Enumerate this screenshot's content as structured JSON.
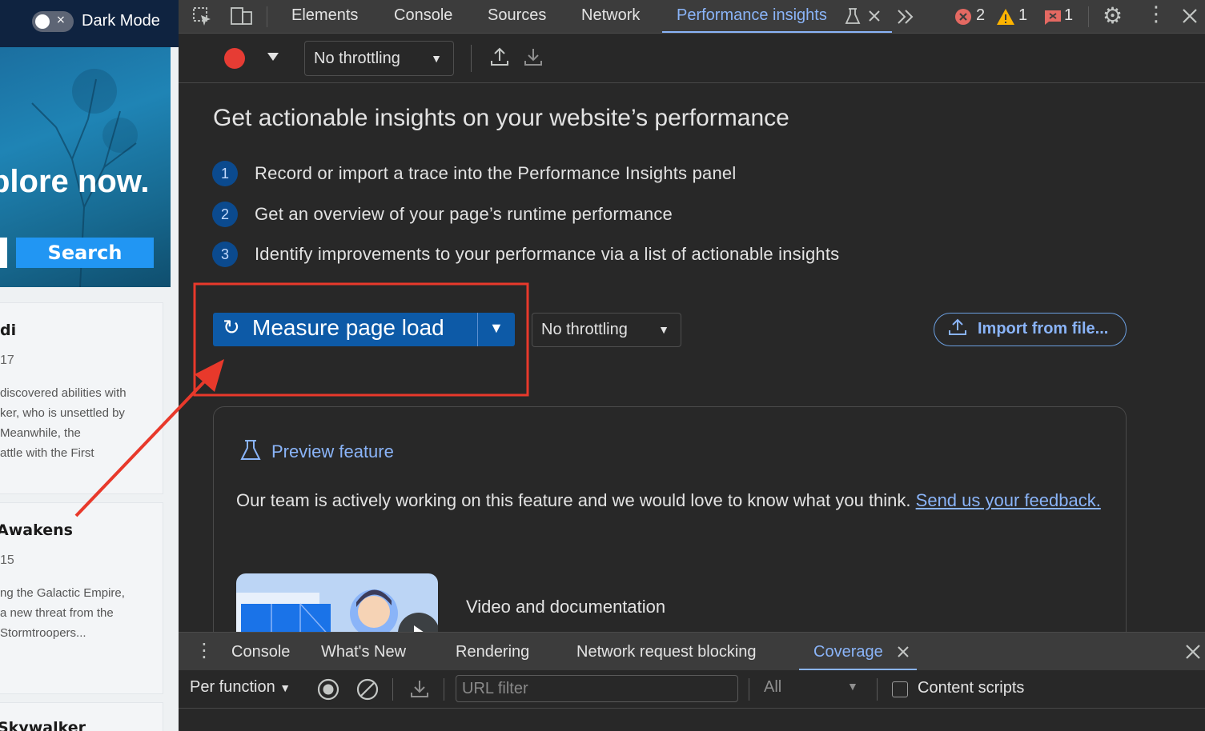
{
  "site": {
    "dark_mode_label": "Dark Mode",
    "toggle_x": "×",
    "hero_text": "plore now.",
    "search_label": "Search",
    "cards": [
      {
        "title": "di",
        "year": "17",
        "desc": [
          "discovered abilities with",
          "ker, who is unsettled by",
          "Meanwhile, the",
          "attle with the First"
        ]
      },
      {
        "title": "Awakens",
        "year": "15",
        "desc": [
          "ng the Galactic Empire,",
          "a new threat from the",
          " Stormtroopers..."
        ]
      },
      {
        "title": "Skywalker",
        "year": "",
        "desc": []
      }
    ]
  },
  "devtools": {
    "tabs": [
      "Elements",
      "Console",
      "Sources",
      "Network",
      "Performance insights"
    ],
    "active_tab": "Performance insights",
    "counts": {
      "errors": "2",
      "warnings": "1",
      "issues": "1"
    },
    "throttling_label": "No throttling",
    "main_title": "Get actionable insights on your website’s performance",
    "steps": [
      {
        "num": "1",
        "text": "Record or import a trace into the Performance Insights panel"
      },
      {
        "num": "2",
        "text": "Get an overview of your page’s runtime performance"
      },
      {
        "num": "3",
        "text": "Identify improvements to your performance via a list of actionable insights"
      }
    ],
    "measure_label": "Measure page load",
    "throttling_dropdown": "No throttling",
    "import_label": "Import from file...",
    "preview": {
      "title": "Preview feature",
      "body": "Our team is actively working on this feature and we would love to know what you think.",
      "link": "Send us your feedback.",
      "video_title": "Video and documentation"
    },
    "drawer": {
      "tabs": [
        "Console",
        "What's New",
        "Rendering",
        "Network request blocking",
        "Coverage"
      ],
      "active": "Coverage",
      "per_function": "Per function",
      "url_filter_placeholder": "URL filter",
      "all_label": "All",
      "content_scripts": "Content scripts"
    }
  },
  "colors": {
    "accent": "#8ab4f8",
    "record": "#e63c34",
    "annotation": "#e8392b",
    "primary_button": "#0d5aa7"
  }
}
